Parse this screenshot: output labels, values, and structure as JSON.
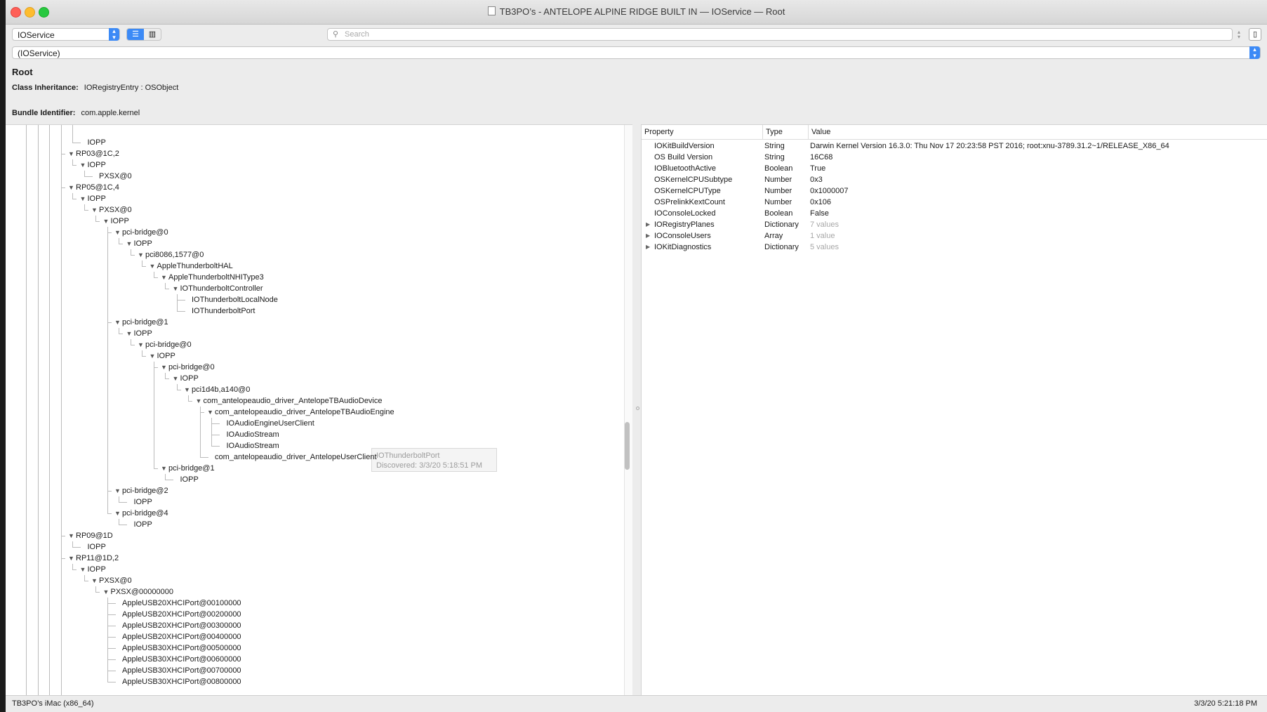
{
  "window": {
    "title": "TB3PO’s - ANTELOPE ALPINE RIDGE BUILT IN — IOService — Root"
  },
  "toolbar": {
    "plane_selected": "IOService",
    "search_placeholder": "Search",
    "path_selected": "(IOService)"
  },
  "info": {
    "title": "Root",
    "class_label": "Class Inheritance:",
    "class_value": "IORegistryEntry : OSObject",
    "bundle_label": "Bundle Identifier:",
    "bundle_value": "com.apple.kernel"
  },
  "tree": [
    {
      "label": "IOPP",
      "depth": 5,
      "expanded": null
    },
    {
      "label": "RP03@1C,2",
      "depth": 4,
      "expanded": true
    },
    {
      "label": "IOPP",
      "depth": 5,
      "expanded": true
    },
    {
      "label": "PXSX@0",
      "depth": 6,
      "expanded": null
    },
    {
      "label": "RP05@1C,4",
      "depth": 4,
      "expanded": true
    },
    {
      "label": "IOPP",
      "depth": 5,
      "expanded": true
    },
    {
      "label": "PXSX@0",
      "depth": 6,
      "expanded": true
    },
    {
      "label": "IOPP",
      "depth": 7,
      "expanded": true
    },
    {
      "label": "pci-bridge@0",
      "depth": 8,
      "expanded": true
    },
    {
      "label": "IOPP",
      "depth": 9,
      "expanded": true
    },
    {
      "label": "pci8086,1577@0",
      "depth": 10,
      "expanded": true
    },
    {
      "label": "AppleThunderboltHAL",
      "depth": 11,
      "expanded": true
    },
    {
      "label": "AppleThunderboltNHIType3",
      "depth": 12,
      "expanded": true
    },
    {
      "label": "IOThunderboltController",
      "depth": 13,
      "expanded": true
    },
    {
      "label": "IOThunderboltLocalNode",
      "depth": 14,
      "expanded": null
    },
    {
      "label": "IOThunderboltPort",
      "depth": 14,
      "expanded": null
    },
    {
      "label": "pci-bridge@1",
      "depth": 8,
      "expanded": true
    },
    {
      "label": "IOPP",
      "depth": 9,
      "expanded": true
    },
    {
      "label": "pci-bridge@0",
      "depth": 10,
      "expanded": true
    },
    {
      "label": "IOPP",
      "depth": 11,
      "expanded": true
    },
    {
      "label": "pci-bridge@0",
      "depth": 12,
      "expanded": true
    },
    {
      "label": "IOPP",
      "depth": 13,
      "expanded": true
    },
    {
      "label": "pci1d4b,a140@0",
      "depth": 14,
      "expanded": true
    },
    {
      "label": "com_antelopeaudio_driver_AntelopeTBAudioDevice",
      "depth": 15,
      "expanded": true
    },
    {
      "label": "com_antelopeaudio_driver_AntelopeTBAudioEngine",
      "depth": 16,
      "expanded": true
    },
    {
      "label": "IOAudioEngineUserClient",
      "depth": 17,
      "expanded": null
    },
    {
      "label": "IOAudioStream",
      "depth": 17,
      "expanded": null
    },
    {
      "label": "IOAudioStream",
      "depth": 17,
      "expanded": null
    },
    {
      "label": "com_antelopeaudio_driver_AntelopeUserClient",
      "depth": 16,
      "expanded": null
    },
    {
      "label": "pci-bridge@1",
      "depth": 12,
      "expanded": true
    },
    {
      "label": "IOPP",
      "depth": 13,
      "expanded": null
    },
    {
      "label": "pci-bridge@2",
      "depth": 8,
      "expanded": true
    },
    {
      "label": "IOPP",
      "depth": 9,
      "expanded": null
    },
    {
      "label": "pci-bridge@4",
      "depth": 8,
      "expanded": true
    },
    {
      "label": "IOPP",
      "depth": 9,
      "expanded": null
    },
    {
      "label": "RP09@1D",
      "depth": 4,
      "expanded": true
    },
    {
      "label": "IOPP",
      "depth": 5,
      "expanded": null
    },
    {
      "label": "RP11@1D,2",
      "depth": 4,
      "expanded": true
    },
    {
      "label": "IOPP",
      "depth": 5,
      "expanded": true
    },
    {
      "label": "PXSX@0",
      "depth": 6,
      "expanded": true
    },
    {
      "label": "PXSX@00000000",
      "depth": 7,
      "expanded": true
    },
    {
      "label": "AppleUSB20XHCIPort@00100000",
      "depth": 8,
      "expanded": null
    },
    {
      "label": "AppleUSB20XHCIPort@00200000",
      "depth": 8,
      "expanded": null
    },
    {
      "label": "AppleUSB20XHCIPort@00300000",
      "depth": 8,
      "expanded": null
    },
    {
      "label": "AppleUSB20XHCIPort@00400000",
      "depth": 8,
      "expanded": null
    },
    {
      "label": "AppleUSB30XHCIPort@00500000",
      "depth": 8,
      "expanded": null
    },
    {
      "label": "AppleUSB30XHCIPort@00600000",
      "depth": 8,
      "expanded": null
    },
    {
      "label": "AppleUSB30XHCIPort@00700000",
      "depth": 8,
      "expanded": null
    },
    {
      "label": "AppleUSB30XHCIPort@00800000",
      "depth": 8,
      "expanded": null
    }
  ],
  "tooltip": {
    "line1": "IOThunderboltPort",
    "line2": "Discovered: 3/3/20 5:18:51 PM"
  },
  "properties": {
    "headers": [
      "Property",
      "Type",
      "Value"
    ],
    "rows": [
      {
        "property": "IOKitBuildVersion",
        "type": "String",
        "value": "Darwin Kernel Version 16.3.0: Thu Nov 17 20:23:58 PST 2016; root:xnu-3789.31.2~1/RELEASE_X86_64",
        "expandable": false,
        "muted": false
      },
      {
        "property": "OS Build Version",
        "type": "String",
        "value": "16C68",
        "expandable": false,
        "muted": false
      },
      {
        "property": "IOBluetoothActive",
        "type": "Boolean",
        "value": "True",
        "expandable": false,
        "muted": false
      },
      {
        "property": "OSKernelCPUSubtype",
        "type": "Number",
        "value": "0x3",
        "expandable": false,
        "muted": false
      },
      {
        "property": "OSKernelCPUType",
        "type": "Number",
        "value": "0x1000007",
        "expandable": false,
        "muted": false
      },
      {
        "property": "OSPrelinkKextCount",
        "type": "Number",
        "value": "0x106",
        "expandable": false,
        "muted": false
      },
      {
        "property": "IOConsoleLocked",
        "type": "Boolean",
        "value": "False",
        "expandable": false,
        "muted": false
      },
      {
        "property": "IORegistryPlanes",
        "type": "Dictionary",
        "value": "7 values",
        "expandable": true,
        "muted": true
      },
      {
        "property": "IOConsoleUsers",
        "type": "Array",
        "value": "1 value",
        "expandable": true,
        "muted": true
      },
      {
        "property": "IOKitDiagnostics",
        "type": "Dictionary",
        "value": "5 values",
        "expandable": true,
        "muted": true
      }
    ]
  },
  "status": {
    "left": "TB3PO’s iMac (x86_64)",
    "right": "3/3/20 5:21:18 PM"
  },
  "colors": {
    "accent": "#3c8af6",
    "close": "#fe5f57",
    "minimize": "#febc2e",
    "zoom": "#28c840"
  }
}
